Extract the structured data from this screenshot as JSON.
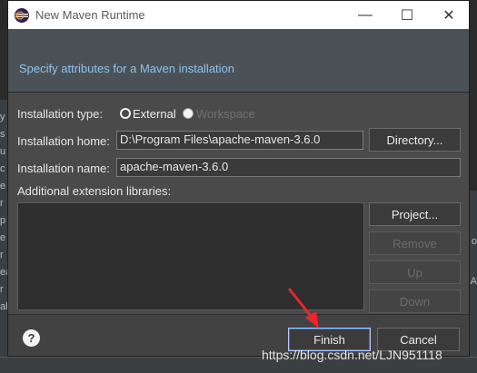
{
  "window": {
    "title": "New Maven Runtime",
    "minimize_glyph": "—",
    "maximize_glyph": "☐",
    "close_glyph": "✕"
  },
  "header": {
    "description": "Specify attributes for a Maven installation"
  },
  "form": {
    "type_label": "Installation type:",
    "type_options": [
      {
        "label": "External",
        "selected": true
      },
      {
        "label": "Workspace",
        "selected": false
      }
    ],
    "home_label": "Installation home:",
    "home_value": "D:\\Program Files\\apache-maven-3.6.0",
    "directory_button": "Directory...",
    "name_label": "Installation name:",
    "name_value": "apache-maven-3.6.0",
    "libraries_label": "Additional extension libraries:",
    "library_buttons": {
      "project": "Project...",
      "remove": "Remove",
      "up": "Up",
      "down": "Down"
    }
  },
  "footer": {
    "help_glyph": "?",
    "finish_label": "Finish",
    "cancel_label": "Cancel"
  },
  "watermark": "https://blog.csdn.net/LJN951118",
  "colors": {
    "accent_link": "#8fc1ea",
    "annotation_arrow": "#e8262c"
  },
  "background_fragments": {
    "left": [
      "y",
      "s",
      "u",
      "c",
      "e",
      "r",
      "p",
      "e",
      "r",
      "ea",
      "r",
      "al"
    ],
    "right": [
      "o",
      "A"
    ]
  }
}
